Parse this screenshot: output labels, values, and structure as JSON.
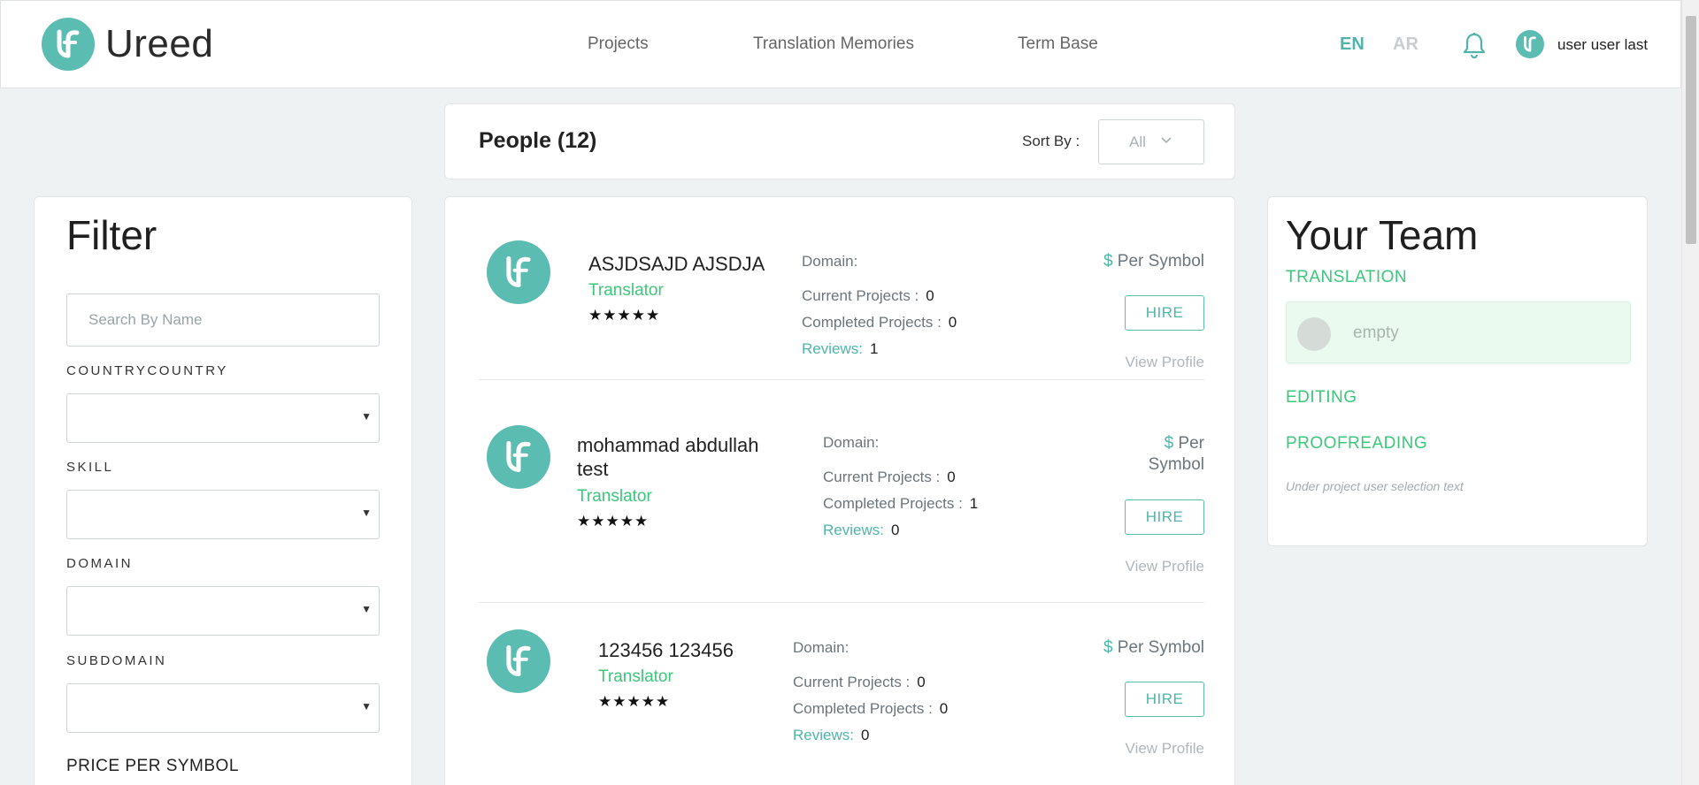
{
  "header": {
    "logo_text": "Ureed",
    "nav": [
      "Projects",
      "Translation Memories",
      "Term Base"
    ],
    "lang_active": "EN",
    "lang_inactive": "AR",
    "user_name": "user user last",
    "accent_color": "#5bbcb2"
  },
  "filter": {
    "title": "Filter",
    "search_placeholder": "Search By Name",
    "labels": {
      "country": "COUNTRYCOUNTRY",
      "skill": "SKILL",
      "domain": "DOMAIN",
      "subdomain": "SUBDOMAIN"
    },
    "price_label": "PRICE PER SYMBOL"
  },
  "people_header": {
    "title": "People (12)",
    "sort_label": "Sort By :",
    "sort_value": "All"
  },
  "people": [
    {
      "name": "ASJDSAJD AJSDJA",
      "role": "Translator",
      "stars": "★★★★★",
      "domain_label": "Domain:",
      "current_label": "Current Projects :",
      "current": "0",
      "completed_label": "Completed Projects :",
      "completed": "0",
      "reviews_label": "Reviews:",
      "reviews": "1",
      "price_symbol": "$",
      "price_text": "Per Symbol",
      "hire": "HIRE",
      "view_profile": "View Profile"
    },
    {
      "name": "mohammad abdullah test",
      "role": "Translator",
      "stars": "★★★★★",
      "domain_label": "Domain:",
      "current_label": "Current Projects :",
      "current": "0",
      "completed_label": "Completed Projects :",
      "completed": "1",
      "reviews_label": "Reviews:",
      "reviews": "0",
      "price_symbol": "$",
      "price_text": "Per Symbol",
      "hire": "HIRE",
      "view_profile": "View Profile"
    },
    {
      "name": "123456 123456",
      "role": "Translator",
      "stars": "★★★★★",
      "domain_label": "Domain:",
      "current_label": "Current Projects :",
      "current": "0",
      "completed_label": "Completed Projects :",
      "completed": "0",
      "reviews_label": "Reviews:",
      "reviews": "0",
      "price_symbol": "$",
      "price_text": "Per Symbol",
      "hire": "HIRE",
      "view_profile": "View Profile"
    }
  ],
  "team": {
    "title": "Your Team",
    "sections": [
      "TRANSLATION",
      "EDITING",
      "PROOFREADING"
    ],
    "slot_empty": "empty",
    "note": "Under project user selection text"
  }
}
